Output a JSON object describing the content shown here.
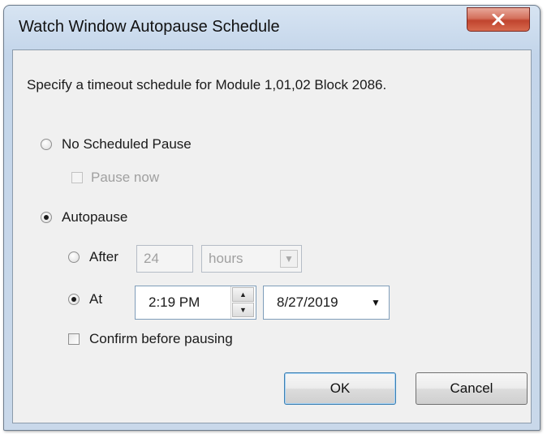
{
  "window": {
    "title": "Watch Window Autopause Schedule",
    "close_icon": "close-x-icon"
  },
  "dialog": {
    "instruction": "Specify a timeout schedule for Module 1,01,02 Block 2086.",
    "no_schedule": {
      "label": "No Scheduled Pause",
      "checked": false
    },
    "pause_now": {
      "label": "Pause now",
      "checked": false,
      "enabled": false
    },
    "autopause": {
      "label": "Autopause",
      "checked": true
    },
    "after": {
      "label": "After",
      "checked": false,
      "value": "24",
      "unit": "hours",
      "enabled": false
    },
    "at": {
      "label": "At",
      "checked": true,
      "time": "2:19 PM",
      "date": "8/27/2019"
    },
    "confirm": {
      "label": "Confirm before pausing",
      "checked": false
    }
  },
  "buttons": {
    "ok": "OK",
    "cancel": "Cancel"
  },
  "colors": {
    "frame": "#c9d8ea",
    "client": "#f0f0f0",
    "close": "#c0442e",
    "disabled_text": "#a0a0a0"
  }
}
